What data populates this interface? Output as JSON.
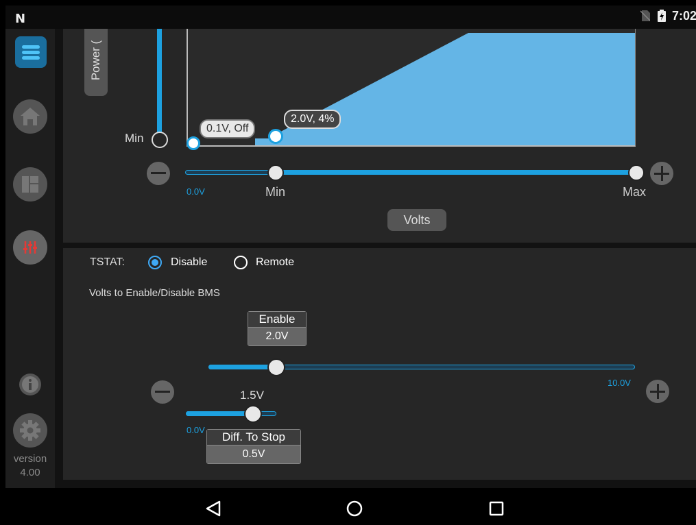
{
  "status": {
    "time": "7:02"
  },
  "sidebar": {
    "version_label": "version",
    "version_number": "4.00"
  },
  "chart": {
    "y_axis_label": "Power (",
    "y_min_label": "Min",
    "point1_label": "0.1V, Off",
    "point2_label": "2.0V, 4%",
    "slider": {
      "min_value_label": "0.0V",
      "min_label": "Min",
      "max_label": "Max"
    },
    "x_axis_button": "Volts"
  },
  "bms": {
    "tstat_label": "TSTAT:",
    "tstat_options": [
      "Disable",
      "Remote"
    ],
    "tstat_selected": "Disable",
    "section_label": "Volts to Enable/Disable BMS",
    "enable": {
      "title": "Enable",
      "value": "2.0V",
      "max_label": "10.0V"
    },
    "diff": {
      "value_label": "1.5V",
      "min_label": "0.0V",
      "title": "Diff. To Stop",
      "value": "0.5V"
    }
  },
  "colors": {
    "accent": "#1da1e0",
    "area_fill": "#64b5e6",
    "panel_bg": "#262626"
  }
}
